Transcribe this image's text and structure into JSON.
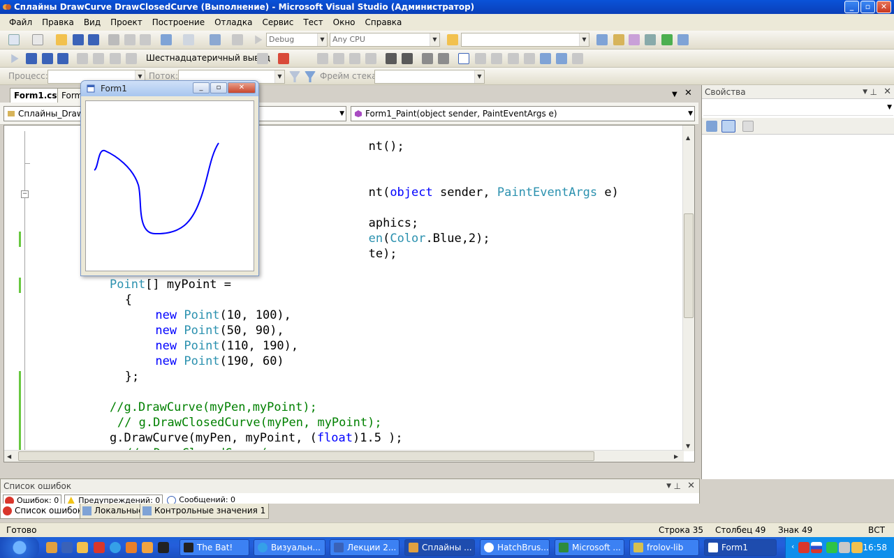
{
  "window": {
    "title": "Сплайны DrawCurve DrawClosedCurve (Выполнение) - Microsoft Visual Studio (Администратор)"
  },
  "menu": [
    "Файл",
    "Правка",
    "Вид",
    "Проект",
    "Построение",
    "Отладка",
    "Сервис",
    "Тест",
    "Окно",
    "Справка"
  ],
  "toolbar": {
    "config": "Debug",
    "platform": "Any CPU",
    "hex_label": "Шестнадцатеричный вывод",
    "process_label": "Процесс:",
    "thread_label": "Поток:",
    "stack_label": "Фрейм стека:"
  },
  "tabs": {
    "active": "Form1.cs*",
    "second": "Form"
  },
  "nav": {
    "left": "Сплайны_DrawC",
    "right": "Form1_Paint(object sender, PaintEventArgs e)"
  },
  "code_lines": [
    {
      "indent": 34,
      "parts": [
        [
          "",
          "nt();"
        ]
      ]
    },
    {
      "indent": 34,
      "parts": [
        [
          "",
          "nt("
        ],
        [
          "kw",
          "object"
        ],
        [
          "",
          " sender, "
        ],
        [
          "ty",
          "PaintEventArgs"
        ],
        [
          "",
          " e)"
        ]
      ]
    },
    {
      "indent": 34,
      "parts": [
        [
          "",
          "aphics;"
        ]
      ]
    },
    {
      "indent": 34,
      "parts": [
        [
          "ty",
          "en"
        ],
        [
          "",
          "("
        ],
        [
          "ty",
          "Color"
        ],
        [
          "",
          ".Blue,2);"
        ]
      ]
    },
    {
      "indent": 34,
      "parts": [
        [
          "",
          "te);"
        ]
      ]
    },
    {
      "indent": 0,
      "parts": [
        [
          "ty",
          "Point"
        ],
        [
          "",
          "[] myPoint ="
        ]
      ]
    },
    {
      "indent": 2,
      "parts": [
        [
          "",
          "{"
        ]
      ]
    },
    {
      "indent": 6,
      "parts": [
        [
          "kw",
          "new"
        ],
        [
          "",
          " "
        ],
        [
          "ty",
          "Point"
        ],
        [
          "",
          "(10, 100),"
        ]
      ]
    },
    {
      "indent": 6,
      "parts": [
        [
          "kw",
          "new"
        ],
        [
          "",
          " "
        ],
        [
          "ty",
          "Point"
        ],
        [
          "",
          "(50, 90),"
        ]
      ]
    },
    {
      "indent": 6,
      "parts": [
        [
          "kw",
          "new"
        ],
        [
          "",
          " "
        ],
        [
          "ty",
          "Point"
        ],
        [
          "",
          "(110, 190),"
        ]
      ]
    },
    {
      "indent": 6,
      "parts": [
        [
          "kw",
          "new"
        ],
        [
          "",
          " "
        ],
        [
          "ty",
          "Point"
        ],
        [
          "",
          "(190, 60)"
        ]
      ]
    },
    {
      "indent": 2,
      "parts": [
        [
          "",
          "};"
        ]
      ]
    },
    {
      "indent": 0,
      "parts": [
        [
          "cm",
          "//g.DrawCurve(myPen,myPoint);"
        ]
      ]
    },
    {
      "indent": 1,
      "parts": [
        [
          "cm",
          "// g.DrawClosedCurve(myPen, myPoint);"
        ]
      ]
    },
    {
      "indent": 0,
      "parts": [
        [
          "",
          "g.DrawCurve(myPen, myPoint, ("
        ],
        [
          "kw",
          "float"
        ],
        [
          "",
          ")1.5 );"
        ]
      ]
    },
    {
      "indent": 2,
      "parts": [
        [
          "cm",
          "//g.DrawClosedCurve("
        ]
      ]
    }
  ],
  "properties": {
    "title": "Свойства"
  },
  "error_list": {
    "title": "Список ошибок",
    "errors": "Ошибок: 0",
    "warnings": "Предупреждений: 0",
    "messages": "Сообщений: 0"
  },
  "bottom_tabs": [
    "Список ошибок",
    "Локальные",
    "Контрольные значения 1"
  ],
  "status": {
    "ready": "Готово",
    "line": "Строка 35",
    "col": "Столбец 49",
    "ch": "Знак 49",
    "mode": "ВСТ"
  },
  "form1": {
    "title": "Form1"
  },
  "taskbar": {
    "tasks": [
      "The Bat!",
      "Визуальн...",
      "Лекции 2...",
      "Сплайны ...",
      "HatchBrus...",
      "Microsoft ...",
      "frolov-lib",
      "Form1"
    ],
    "clock": "16:58"
  }
}
